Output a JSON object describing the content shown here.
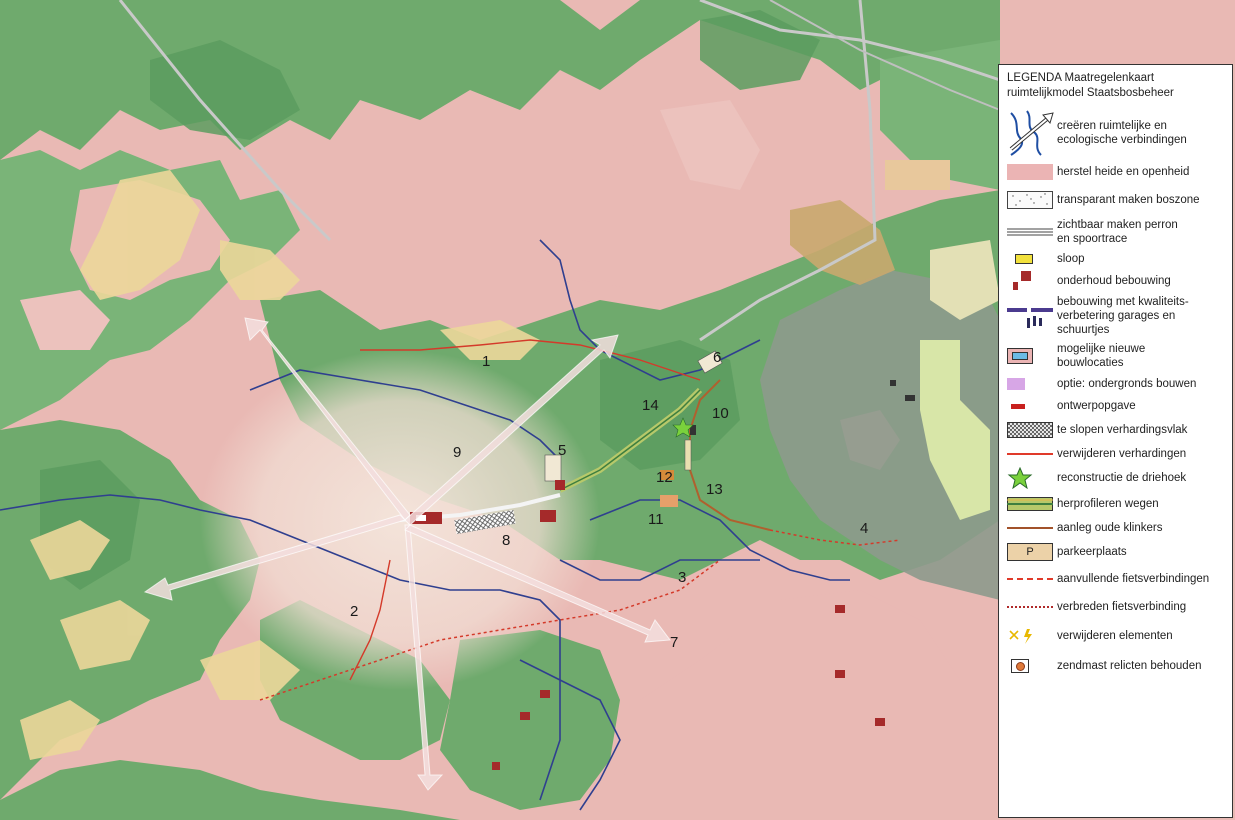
{
  "map": {
    "labels": [
      {
        "id": "1",
        "text": "1"
      },
      {
        "id": "2",
        "text": "2"
      },
      {
        "id": "3",
        "text": "3"
      },
      {
        "id": "4",
        "text": "4"
      },
      {
        "id": "5",
        "text": "5"
      },
      {
        "id": "6",
        "text": "6"
      },
      {
        "id": "7",
        "text": "7"
      },
      {
        "id": "8",
        "text": "8"
      },
      {
        "id": "9",
        "text": "9"
      },
      {
        "id": "10",
        "text": "10"
      },
      {
        "id": "11",
        "text": "11"
      },
      {
        "id": "12",
        "text": "12"
      },
      {
        "id": "13",
        "text": "13"
      },
      {
        "id": "14",
        "text": "14"
      }
    ],
    "colors": {
      "heath_pink": "#e9b9b4",
      "forest_green": "#6faa6d",
      "dark_forest": "#4f8f55",
      "sand_yellow": "#ecd79a",
      "grey_zone": "#8d9a8c",
      "light_green": "#d8e6a8",
      "road_grey": "#c9c9c9",
      "blue_line": "#2f3f8f",
      "red_line": "#d43a2a"
    }
  },
  "legend": {
    "title_line1": "LEGENDA Maatregelenkaart",
    "title_line2": "ruimtelijkmodel Staatsbosbeheer",
    "items": [
      {
        "key": "connections",
        "label_line1": "creëren ruimtelijke en",
        "label_line2": "ecologische verbindingen",
        "icon": "arrow-river-icon"
      },
      {
        "key": "heath",
        "label_line1": "herstel heide en openheid",
        "label_line2": "",
        "icon": "pink-area-icon"
      },
      {
        "key": "transparent",
        "label_line1": "transparant maken boszone",
        "label_line2": "",
        "icon": "dotted-area-icon"
      },
      {
        "key": "platform",
        "label_line1": "zichtbaar maken perron",
        "label_line2": "en spoortrace",
        "icon": "double-line-icon"
      },
      {
        "key": "demolish",
        "label_line1": "sloop",
        "label_line2": "",
        "icon": "yellow-block-icon"
      },
      {
        "key": "maintain",
        "label_line1": "onderhoud bebouwing",
        "label_line2": "",
        "icon": "red-buildings-icon"
      },
      {
        "key": "quality",
        "label_line1": "bebouwing met  kwaliteits-",
        "label_line2": "verbetering garages en",
        "label_line3": "schuurtjes",
        "icon": "purple-buildings-icon"
      },
      {
        "key": "new_locations",
        "label_line1": "mogelijke nieuwe",
        "label_line2": "bouwlocaties",
        "icon": "blue-box-icon"
      },
      {
        "key": "underground",
        "label_line1": "optie: ondergronds bouwen",
        "label_line2": "",
        "icon": "violet-box-icon"
      },
      {
        "key": "design",
        "label_line1": "ontwerpopgave",
        "label_line2": "",
        "icon": "red-bar-icon"
      },
      {
        "key": "paving_demolish",
        "label_line1": "te slopen verhardingsvlak",
        "label_line2": "",
        "icon": "hatched-box-icon"
      },
      {
        "key": "remove_paving",
        "label_line1": "verwijderen verhardingen",
        "label_line2": "",
        "icon": "red-line-icon"
      },
      {
        "key": "triangle",
        "label_line1": "reconstructie de driehoek",
        "label_line2": "",
        "icon": "green-star-icon"
      },
      {
        "key": "roads",
        "label_line1": "herprofileren wegen",
        "label_line2": "",
        "icon": "road-profile-icon"
      },
      {
        "key": "cobbles",
        "label_line1": "aanleg oude klinkers",
        "label_line2": "",
        "icon": "brown-line-icon"
      },
      {
        "key": "parking",
        "label_line1": "parkeerplaats",
        "label_line2": "",
        "icon": "parking-icon",
        "symbol_text": "P"
      },
      {
        "key": "bike_extra",
        "label_line1": "aanvullende fietsverbindingen",
        "label_line2": "",
        "icon": "dashed-red-line-icon"
      },
      {
        "key": "bike_widen",
        "label_line1": "verbreden fietsverbinding",
        "label_line2": "",
        "icon": "dotted-red-line-icon"
      },
      {
        "key": "remove_elements",
        "label_line1": "verwijderen elementen",
        "label_line2": "",
        "icon": "cross-bolt-icon"
      },
      {
        "key": "mast",
        "label_line1": "zendmast relicten behouden",
        "label_line2": "",
        "icon": "mast-relic-icon"
      }
    ]
  }
}
